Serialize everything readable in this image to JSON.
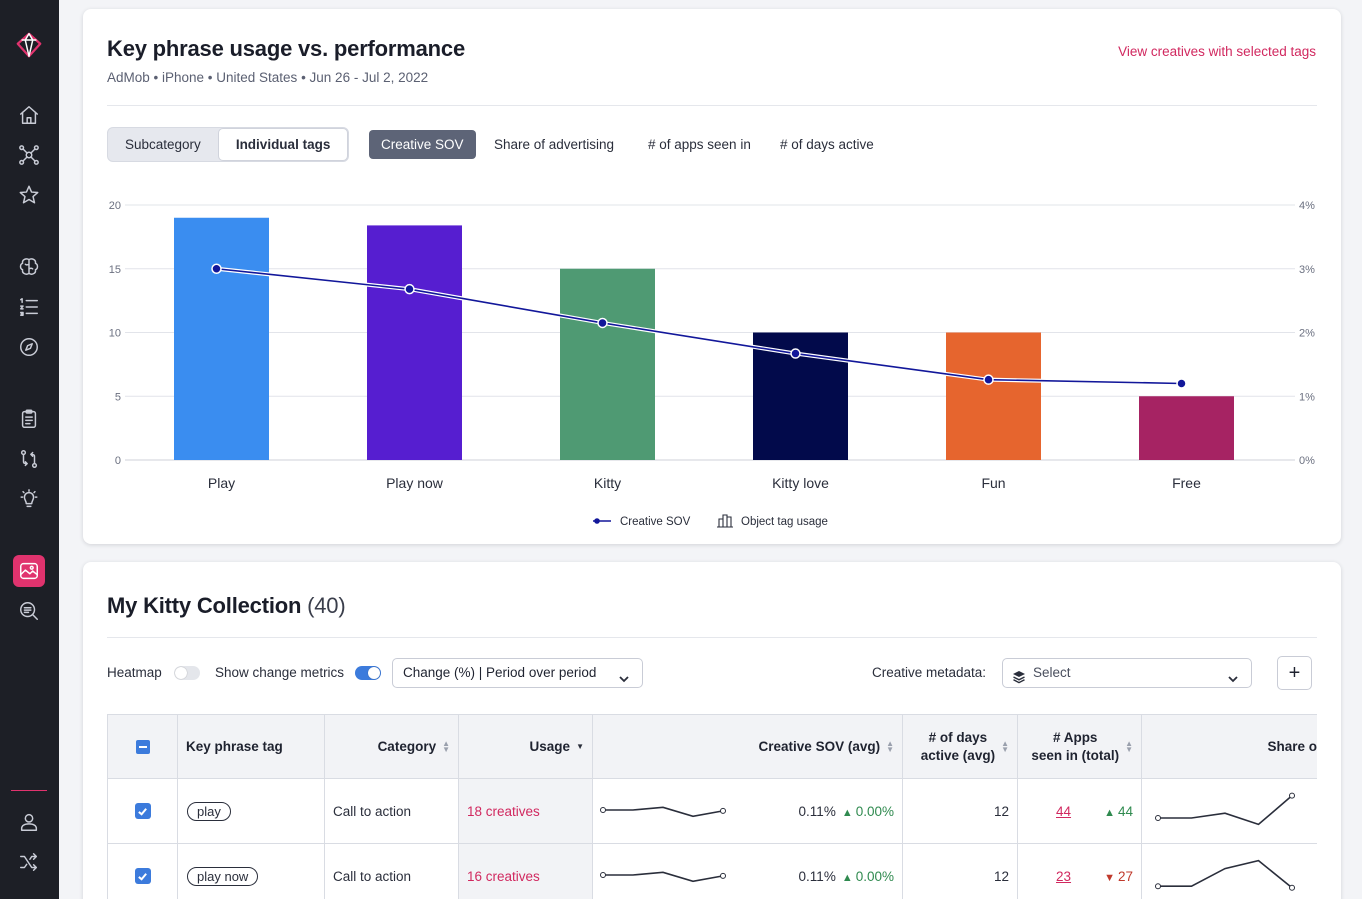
{
  "sidebar": {
    "items": [
      {
        "name": "logo-icon"
      },
      {
        "name": "home-icon"
      },
      {
        "name": "network-icon"
      },
      {
        "name": "star-icon"
      },
      {
        "name": "brain-icon"
      },
      {
        "name": "ordered-list-icon"
      },
      {
        "name": "compass-icon"
      },
      {
        "name": "clipboard-icon"
      },
      {
        "name": "compare-icon"
      },
      {
        "name": "lightbulb-icon"
      },
      {
        "name": "image-icon",
        "active": true
      },
      {
        "name": "search-text-icon"
      },
      {
        "name": "user-icon"
      },
      {
        "name": "shuffle-icon"
      }
    ],
    "accent": "#e0336e"
  },
  "performance": {
    "title": "Key phrase usage vs. performance",
    "subtitle": "AdMob • iPhone • United States • Jun 26 - Jul 2, 2022",
    "link": "View creatives with selected tags",
    "grouping": [
      "Subcategory",
      "Individual tags"
    ],
    "grouping_selected": "Individual tags",
    "metrics": [
      "Creative SOV",
      "Share of advertising",
      "# of apps seen in",
      "# of days active"
    ],
    "metric_selected": "Creative SOV"
  },
  "chart_data": {
    "type": "bar",
    "categories": [
      "Play",
      "Play now",
      "Kitty",
      "Kitty love",
      "Fun",
      "Free"
    ],
    "series": [
      {
        "name": "Object tag usage",
        "kind": "bar",
        "axis": "left",
        "values": [
          19,
          18.4,
          15,
          10,
          10,
          5
        ],
        "colors": [
          "#3a8df0",
          "#561ed0",
          "#4f9a73",
          "#020a4b",
          "#e6652e",
          "#a62363"
        ]
      },
      {
        "name": "Creative SOV",
        "kind": "line",
        "axis": "right",
        "values": [
          3.0,
          2.68,
          2.15,
          1.67,
          1.26,
          1.2
        ],
        "color": "#12179a"
      }
    ],
    "y_left": {
      "ticks": [
        "0",
        "5",
        "10",
        "15",
        "20"
      ],
      "lim": [
        0,
        20
      ]
    },
    "y_right": {
      "ticks": [
        "0%",
        "1%",
        "2%",
        "3%",
        "4%"
      ],
      "lim": [
        0,
        4
      ]
    },
    "grid": true,
    "legend": "bottom-center"
  },
  "collection": {
    "title": "My Kitty Collection",
    "count": "(40)",
    "heatmap_label": "Heatmap",
    "heatmap_on": false,
    "change_label": "Show change metrics",
    "change_on": true,
    "change_select": "Change (%) | Period over period",
    "metadata_label": "Creative metadata:",
    "metadata_placeholder": "Select",
    "add_label": "+"
  },
  "table": {
    "headers": {
      "tag": "Key phrase tag",
      "category": "Category",
      "usage": "Usage",
      "sov": "Creative SOV (avg)",
      "days_1": "# of days",
      "days_2": "active (avg)",
      "apps_1": "# Apps",
      "apps_2": "seen in (total)",
      "share": "Share o"
    },
    "rows": [
      {
        "tag": "play",
        "category": "Call to action",
        "usage": "18 creatives",
        "sov": "0.11%",
        "sov_change": "0.00%",
        "sov_dir": "up",
        "days": "12",
        "apps": "44",
        "apps_change": "44",
        "apps_dir": "up",
        "sov_spark": [
          0.5,
          0.5,
          0.35,
          0.85,
          0.55
        ],
        "share_spark": [
          0.75,
          0.75,
          0.6,
          0.95,
          0.05
        ]
      },
      {
        "tag": "play now",
        "category": "Call to action",
        "usage": "16 creatives",
        "sov": "0.11%",
        "sov_change": "0.00%",
        "sov_dir": "up",
        "days": "12",
        "apps": "23",
        "apps_change": "27",
        "apps_dir": "down",
        "sov_spark": [
          0.5,
          0.5,
          0.35,
          0.85,
          0.55
        ],
        "share_spark": [
          0.85,
          0.85,
          0.3,
          0.05,
          0.9
        ]
      }
    ]
  }
}
